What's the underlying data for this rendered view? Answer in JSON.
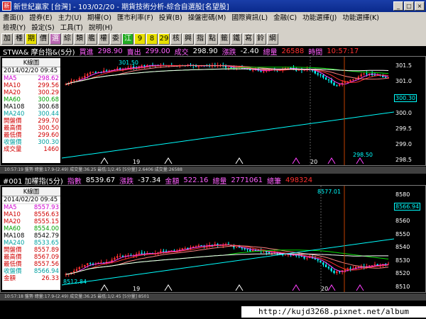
{
  "window": {
    "title": "新世紀贏家 [台灣] - 103/02/20 - 期貨技術分析-綜合自選股[名望股]",
    "app_icon": "app-icon"
  },
  "menu": {
    "row1": [
      "畫面(I)",
      "證券(E)",
      "主力(U)",
      "期權(O)",
      "匯市利率(F)",
      "投資(B)",
      "操盤密碼(M)",
      "國際資訊(L)",
      "金融(C)",
      "功能選擇(J)",
      "功能選擇(K)"
    ],
    "row2": [
      "檢視(Y)",
      "設定(S)",
      "工具(T)",
      "說明(H)"
    ]
  },
  "toolbar": [
    "加",
    "種",
    "期",
    "價",
    "選",
    "綜",
    "類",
    "艦",
    "權",
    "委",
    "江",
    "9",
    "8",
    "29",
    "核",
    "興",
    "指",
    "點",
    "籤",
    "鐵",
    "寫",
    "鈴",
    "綱"
  ],
  "panel1": {
    "name": "STWA& 摩台指&(5分)",
    "bid_label": "買進",
    "bid": "298.90",
    "ask_label": "賣出",
    "ask": "299.00",
    "last_label": "成交",
    "last": "298.90",
    "chg_label": "漲跌",
    "chg": "-2.40",
    "vol_label": "總量",
    "vol": "26588",
    "time_label": "時間",
    "time": "10:57:17",
    "side_header": "K線圖",
    "side_date": "2014/02/20 09:45",
    "rows": [
      {
        "k": "MA5",
        "v": "298.62",
        "c": "#d000d0"
      },
      {
        "k": "MA10",
        "v": "299.56",
        "c": "#d00000"
      },
      {
        "k": "MA20",
        "v": "300.29",
        "c": "#d00000"
      },
      {
        "k": "MA60",
        "v": "300.68",
        "c": "#00a000"
      },
      {
        "k": "MA108",
        "v": "300.68",
        "c": "#000000"
      },
      {
        "k": "MA240",
        "v": "300.44",
        "c": "#00a0a0"
      },
      {
        "k": "開盤價",
        "v": "299.70",
        "c": "#d00000"
      },
      {
        "k": "最高價",
        "v": "300.50",
        "c": "#d00000"
      },
      {
        "k": "最低價",
        "v": "299.60",
        "c": "#d00000"
      },
      {
        "k": "收盤價",
        "v": "300.30",
        "c": "#00a0a0"
      },
      {
        "k": "成交量",
        "v": "1460",
        "c": "#d00000"
      }
    ],
    "y_ticks": [
      "301.5",
      "301.0",
      "300.5",
      "300.0",
      "299.5",
      "299.0",
      "298.5"
    ],
    "current_price_label": "300.30",
    "x_labels": [
      "19",
      "20"
    ],
    "peak_label": "301.50",
    "low_label": "298.50",
    "status": "10:57:19 盤勢 總量:17.9-(2.49) 成交量:36.25 最低:1/2.45 [5分量] 2.6406 成交量:26588"
  },
  "panel2": {
    "name": "#001 加權指(5分)",
    "index_label": "指數",
    "index": "8539.67",
    "chg_label": "漲跌",
    "chg": "-37.34",
    "amt_label": "金額",
    "amt": "522.16",
    "vol_label": "總量",
    "vol": "2771061",
    "tot_label": "總筆",
    "tot": "498324",
    "side_header": "K線圖",
    "side_date": "2014/02/20 09:45",
    "rows": [
      {
        "k": "MA5",
        "v": "8557.93",
        "c": "#d000d0"
      },
      {
        "k": "MA10",
        "v": "8556.63",
        "c": "#d00000"
      },
      {
        "k": "MA20",
        "v": "8555.15",
        "c": "#d00000"
      },
      {
        "k": "MA60",
        "v": "8554.00",
        "c": "#00a000"
      },
      {
        "k": "MA108",
        "v": "8542.79",
        "c": "#000000"
      },
      {
        "k": "MA240",
        "v": "8533.65",
        "c": "#00a0a0"
      },
      {
        "k": "開盤價",
        "v": "8557.89",
        "c": "#d00000"
      },
      {
        "k": "最高價",
        "v": "8567.09",
        "c": "#d00000"
      },
      {
        "k": "最低價",
        "v": "8557.56",
        "c": "#d00000"
      },
      {
        "k": "收盤價",
        "v": "8566.94",
        "c": "#00a0a0"
      },
      {
        "k": "金額",
        "v": "26.33",
        "c": "#d00000"
      }
    ],
    "y_ticks": [
      "8580",
      "8570",
      "8560",
      "8550",
      "8540",
      "8530",
      "8520",
      "8510"
    ],
    "current_price_label": "8566.94",
    "x_labels": [
      "19",
      "20"
    ],
    "peak_label": "8577.01",
    "low_label": "8512.84",
    "status": "10:57:18 盤勢 總量:17.9-(2.49) 成交量:36.25 最低:1/2.45 [5分量] 8501"
  },
  "watermark": "http://kujd3268.pixnet.net/album"
}
